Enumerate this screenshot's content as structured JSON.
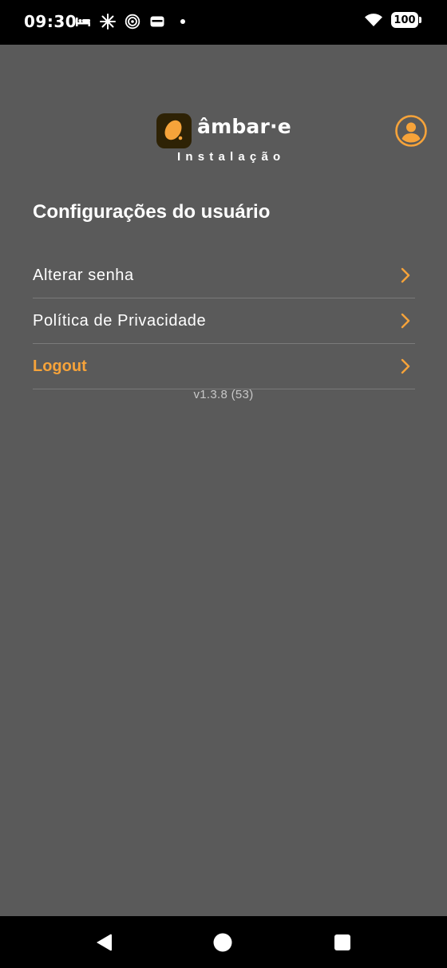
{
  "status_bar": {
    "time": "09:30",
    "battery": "100",
    "icons": [
      "bed-icon",
      "sparkle-icon",
      "hotspot-icon",
      "wallet-icon",
      "notification-dot-icon",
      "wifi-icon",
      "battery-icon"
    ]
  },
  "header": {
    "brand": "âmbar·e",
    "subtitle": "Instalação",
    "logo_icon": "ambar-logo-icon",
    "profile_icon": "account-circle-icon"
  },
  "page": {
    "title": "Configurações do usuário"
  },
  "menu": {
    "items": [
      {
        "label": "Alterar senha",
        "icon": "chevron-right-icon"
      },
      {
        "label": "Política de Privacidade",
        "icon": "chevron-right-icon"
      },
      {
        "label": "Logout",
        "icon": "chevron-right-icon"
      }
    ]
  },
  "version": "v1.3.8 (53)",
  "nav_bar": {
    "buttons": [
      "back-icon",
      "home-icon",
      "recents-icon"
    ]
  },
  "colors": {
    "background": "#5a5a5a",
    "accent": "#f6a33a",
    "divider": "#7a7a7a",
    "status_bar": "#000000"
  }
}
